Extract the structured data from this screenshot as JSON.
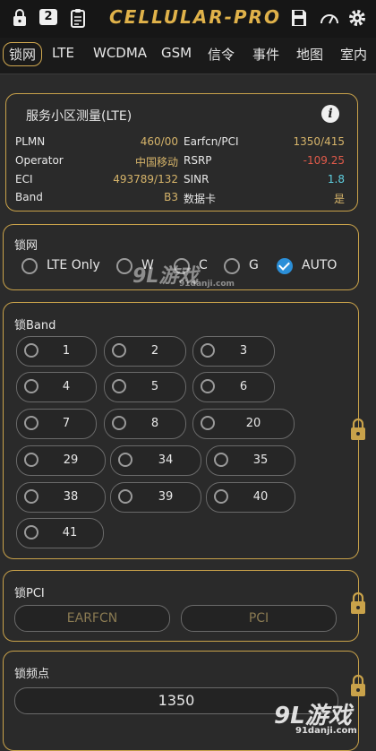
{
  "app": {
    "logo": "CELLULAR-PRO",
    "badge": "2"
  },
  "tabs": [
    "锁网",
    "LTE",
    "WCDMA",
    "GSM",
    "信令",
    "事件",
    "地图",
    "室内"
  ],
  "serving": {
    "title": "服务小区测量(LTE)",
    "info": "i",
    "rows": [
      {
        "k1": "PLMN",
        "v1": "460/00",
        "k2": "Earfcn/PCI",
        "v2": "1350/415"
      },
      {
        "k1": "Operator",
        "v1": "中国移动",
        "k2": "RSRP",
        "v2": "-109.25"
      },
      {
        "k1": "ECI",
        "v1": "493789/132",
        "k2": "SINR",
        "v2": "1.8"
      },
      {
        "k1": "Band",
        "v1": "B3",
        "k2": "数据卡",
        "v2": "是"
      }
    ]
  },
  "network_lock": {
    "title": "锁网",
    "options": [
      "LTE Only",
      "W",
      "C",
      "G",
      "AUTO"
    ],
    "selected": "AUTO"
  },
  "band_lock": {
    "title": "锁Band",
    "bands": [
      "1",
      "2",
      "3",
      "4",
      "5",
      "6",
      "7",
      "8",
      "20",
      "29",
      "34",
      "35",
      "38",
      "39",
      "40",
      "41"
    ]
  },
  "pci_lock": {
    "title": "锁PCI",
    "earfcn_placeholder": "EARFCN",
    "pci_placeholder": "PCI"
  },
  "freq_lock": {
    "title": "锁频点",
    "value": "1350"
  },
  "watermarks": {
    "mid": "9L游戏",
    "mid_sub": "91danji.com",
    "bottom": "9L游戏",
    "bottom_sub": "91danji.com"
  },
  "colors": {
    "accent": "#c9a24a",
    "value": "#d6b46a",
    "rsrp": "#e05a4a",
    "sinr": "#5fd0e0",
    "check": "#2b8fd8"
  }
}
